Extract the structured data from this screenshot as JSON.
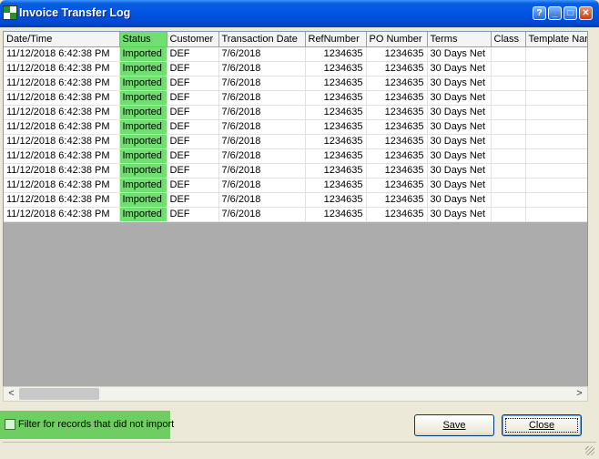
{
  "window": {
    "title": "Invoice Transfer Log",
    "controls": [
      "help",
      "minimize",
      "maximize",
      "close"
    ]
  },
  "grid": {
    "columns": [
      "Date/Time",
      "Status",
      "Customer",
      "Transaction Date",
      "RefNumber",
      "PO Number",
      "Terms",
      "Class",
      "Template Nam"
    ],
    "rows": [
      [
        "11/12/2018 6:42:38 PM",
        "Imported",
        "DEF",
        "7/6/2018",
        "1234635",
        "1234635",
        "30 Days Net",
        "",
        ""
      ],
      [
        "11/12/2018 6:42:38 PM",
        "Imported",
        "DEF",
        "7/6/2018",
        "1234635",
        "1234635",
        "30 Days Net",
        "",
        ""
      ],
      [
        "11/12/2018 6:42:38 PM",
        "Imported",
        "DEF",
        "7/6/2018",
        "1234635",
        "1234635",
        "30 Days Net",
        "",
        ""
      ],
      [
        "11/12/2018 6:42:38 PM",
        "Imported",
        "DEF",
        "7/6/2018",
        "1234635",
        "1234635",
        "30 Days Net",
        "",
        ""
      ],
      [
        "11/12/2018 6:42:38 PM",
        "Imported",
        "DEF",
        "7/6/2018",
        "1234635",
        "1234635",
        "30 Days Net",
        "",
        ""
      ],
      [
        "11/12/2018 6:42:38 PM",
        "Imported",
        "DEF",
        "7/6/2018",
        "1234635",
        "1234635",
        "30 Days Net",
        "",
        ""
      ],
      [
        "11/12/2018 6:42:38 PM",
        "Imported",
        "DEF",
        "7/6/2018",
        "1234635",
        "1234635",
        "30 Days Net",
        "",
        ""
      ],
      [
        "11/12/2018 6:42:38 PM",
        "Imported",
        "DEF",
        "7/6/2018",
        "1234635",
        "1234635",
        "30 Days Net",
        "",
        ""
      ],
      [
        "11/12/2018 6:42:38 PM",
        "Imported",
        "DEF",
        "7/6/2018",
        "1234635",
        "1234635",
        "30 Days Net",
        "",
        ""
      ],
      [
        "11/12/2018 6:42:38 PM",
        "Imported",
        "DEF",
        "7/6/2018",
        "1234635",
        "1234635",
        "30 Days Net",
        "",
        ""
      ],
      [
        "11/12/2018 6:42:38 PM",
        "Imported",
        "DEF",
        "7/6/2018",
        "1234635",
        "1234635",
        "30 Days Net",
        "",
        ""
      ],
      [
        "11/12/2018 6:42:38 PM",
        "Imported",
        "DEF",
        "7/6/2018",
        "1234635",
        "1234635",
        "30 Days Net",
        "",
        ""
      ]
    ],
    "highlight_color": "#6fe06f"
  },
  "filter": {
    "label": "Filter for records that did not import",
    "checked": false
  },
  "buttons": {
    "save_label": "Save",
    "close_label": "Close"
  },
  "colors": {
    "titlebar": "#0054e3",
    "highlight": "#6fe06f",
    "grid_empty": "#acacac"
  }
}
